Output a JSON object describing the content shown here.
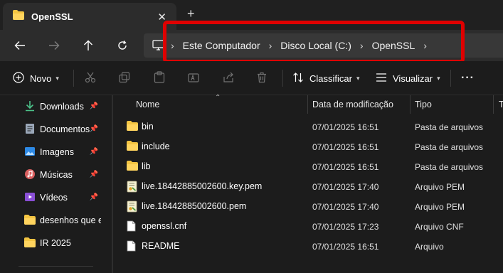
{
  "window": {
    "tab_title": "OpenSSL",
    "tab_close": "✕",
    "new_tab": "+"
  },
  "breadcrumb": {
    "items": [
      "Este Computador",
      "Disco Local (C:)",
      "OpenSSL"
    ],
    "separator": "›"
  },
  "toolbar": {
    "new_label": "Novo",
    "sort_label": "Classificar",
    "view_label": "Visualizar",
    "more_label": "···"
  },
  "sidebar": {
    "items": [
      {
        "label": "Downloads",
        "icon": "download-icon",
        "pinned": true
      },
      {
        "label": "Documentos",
        "icon": "document-icon",
        "pinned": true
      },
      {
        "label": "Imagens",
        "icon": "image-icon",
        "pinned": true
      },
      {
        "label": "Músicas",
        "icon": "music-icon",
        "pinned": true
      },
      {
        "label": "Vídeos",
        "icon": "video-icon",
        "pinned": true
      },
      {
        "label": "desenhos que eu",
        "icon": "folder-icon",
        "pinned": false
      },
      {
        "label": "IR 2025",
        "icon": "folder-icon",
        "pinned": false
      }
    ]
  },
  "columns": {
    "name": "Nome",
    "date": "Data de modificação",
    "type": "Tipo",
    "extra": "T"
  },
  "files": [
    {
      "name": "bin",
      "date": "07/01/2025 16:51",
      "type": "Pasta de arquivos",
      "icon": "folder-icon"
    },
    {
      "name": "include",
      "date": "07/01/2025 16:51",
      "type": "Pasta de arquivos",
      "icon": "folder-icon"
    },
    {
      "name": "lib",
      "date": "07/01/2025 16:51",
      "type": "Pasta de arquivos",
      "icon": "folder-icon"
    },
    {
      "name": "live.18442885002600.key.pem",
      "date": "07/01/2025 17:40",
      "type": "Arquivo PEM",
      "icon": "certificate-file-icon"
    },
    {
      "name": "live.18442885002600.pem",
      "date": "07/01/2025 17:40",
      "type": "Arquivo PEM",
      "icon": "certificate-file-icon"
    },
    {
      "name": "openssl.cnf",
      "date": "07/01/2025 17:23",
      "type": "Arquivo CNF",
      "icon": "file-icon"
    },
    {
      "name": "README",
      "date": "07/01/2025 16:51",
      "type": "Arquivo",
      "icon": "file-icon"
    }
  ],
  "colors": {
    "highlight": "#e00000",
    "folder": "#f4c542",
    "background": "#1c1c1c"
  }
}
